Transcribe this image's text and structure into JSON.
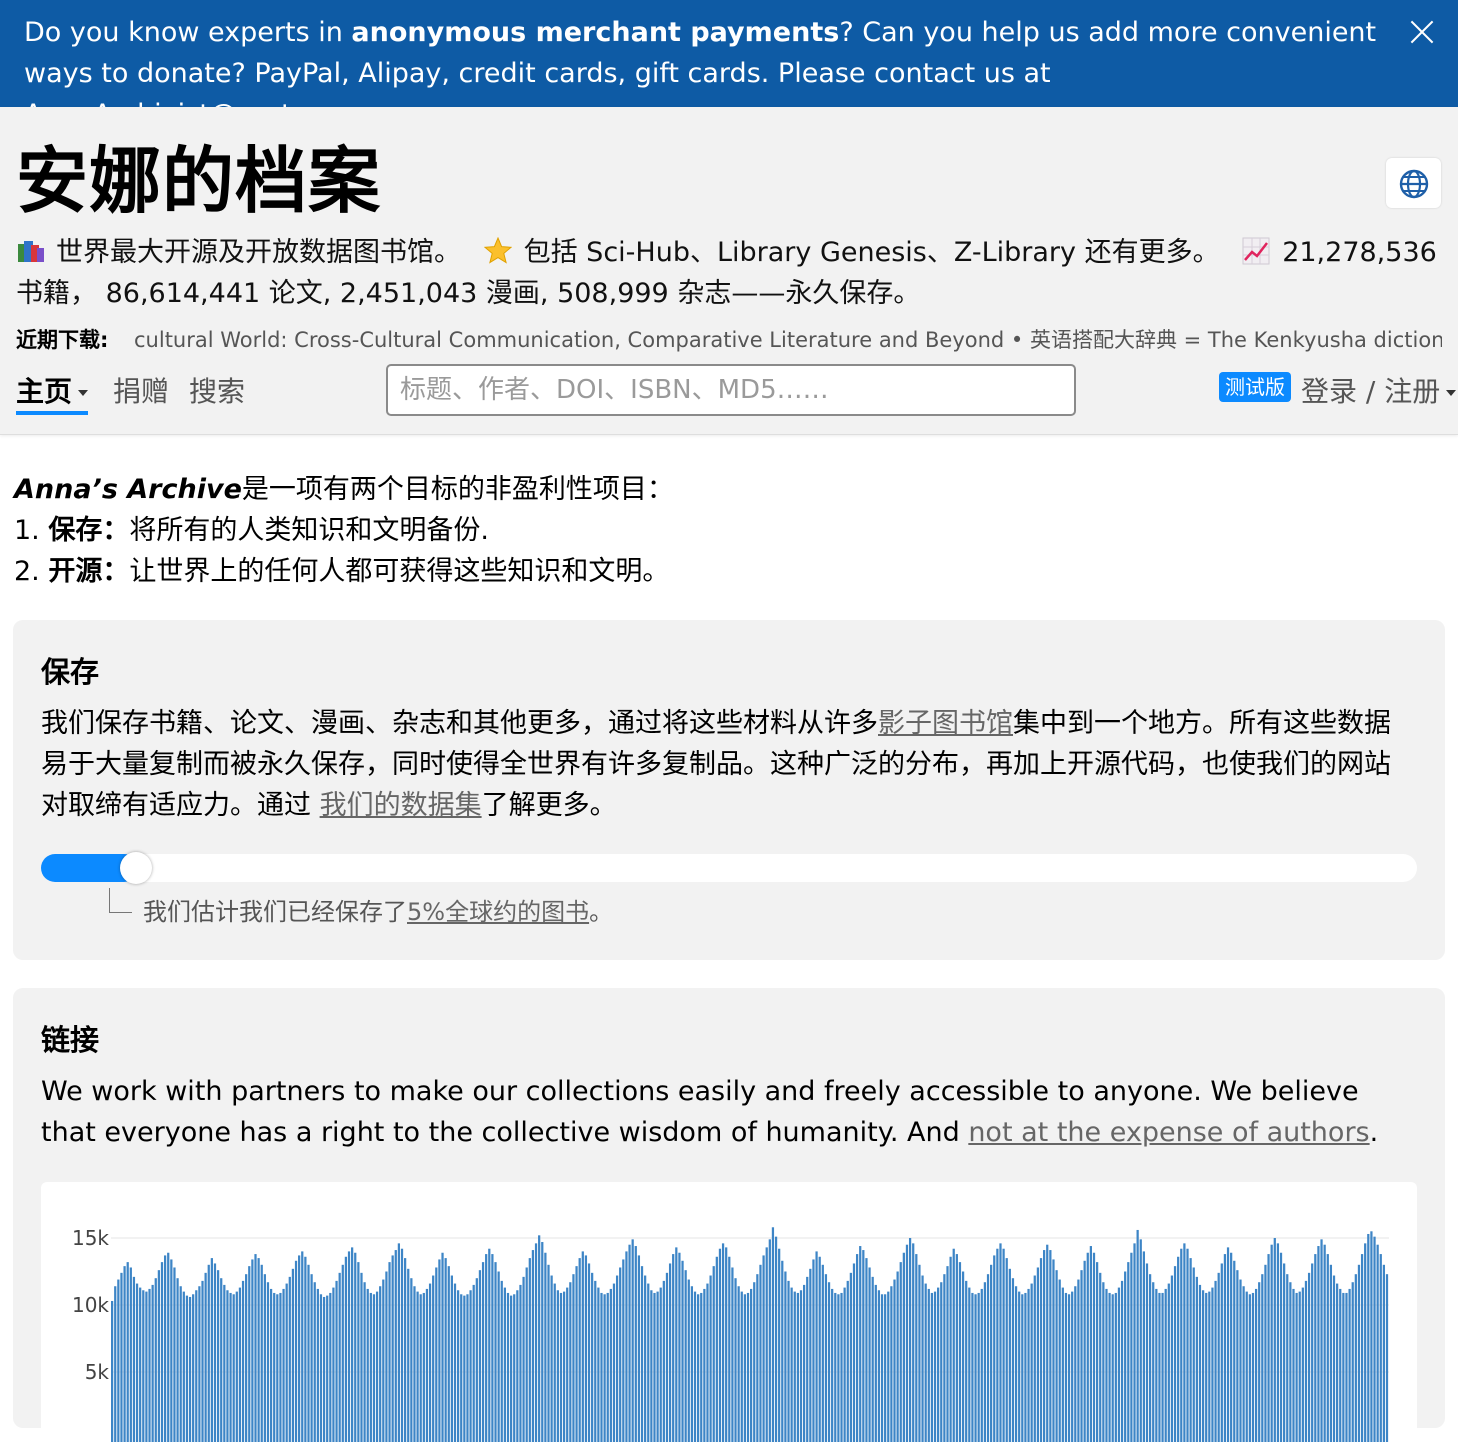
{
  "banner": {
    "part1": "Do you know experts in ",
    "bold": "anonymous merchant payments",
    "part2": "? Can you help us add more convenient ways to donate? PayPal, Alipay, credit cards, gift cards. Please contact us at ",
    "email": "AnnaArchivist@proton.me",
    "part3": ".",
    "close_icon": "close-icon"
  },
  "header": {
    "title": "安娜的档案",
    "language_icon": "globe-icon",
    "stats": {
      "icon1": "books-icon",
      "text1": "世界最大开源及开放数据图书馆。",
      "icon2": "star-icon",
      "text2": "包括 Sci-Hub、Library Genesis、Z-Library 还有更多。",
      "icon3": "chart-increasing-icon",
      "text3": "21,278,536 书籍， 86,614,441 论文, 2,451,043 漫画, 508,999 杂志——永久保存。"
    },
    "recent_label": "近期下载:",
    "recent_ticker": "cultural World: Cross-Cultural Communication, Comparative Literature and Beyond • 英语搭配大辞典 = The Kenkyusha dictionary of E",
    "nav": {
      "home": "主页",
      "donate": "捐赠",
      "search": "搜索"
    },
    "search_placeholder": "标题、作者、DOI、ISBN、MD5……",
    "beta_badge": "测试版",
    "login": "登录 / 注册"
  },
  "intro": {
    "brand": "Anna’s Archive",
    "lead": "是一项有两个目标的非盈利性项目：",
    "item1_num": "1. ",
    "item1_term": "保存：",
    "item1_text": "将所有的人类知识和文明备份.",
    "item2_num": "2. ",
    "item2_term": "开源：",
    "item2_text": "让世界上的任何人都可获得这些知识和文明。"
  },
  "preserve": {
    "heading": "保存",
    "text_a": "我们保存书籍、论文、漫画、杂志和其他更多，通过将这些材料从许多",
    "link_shadow": "影子图书馆",
    "text_b": "集中到一个地方。所有这些数据易于大量复制而被永久保存，同时使得全世界有许多复制品。这种广泛的分布，再加上开源代码，也使我们的网站对取缔有适应力。通过 ",
    "link_datasets": "我们的数据集",
    "text_c": "了解更多。",
    "progress_fraction": 0.05,
    "progress_color": "#0c8aff",
    "note_a": "我们估计我们已经保存了",
    "note_link": "5%全球约的图书",
    "note_b": "。"
  },
  "links": {
    "heading": "链接",
    "text_a": "We work with partners to make our collections easily and freely accessible to anyone. We believe that everyone has a right to the collective wisdom of humanity. And ",
    "link": "not at the expense of authors",
    "text_b": "."
  },
  "chart_data": {
    "type": "bar",
    "title": "",
    "xlabel": "",
    "ylabel": "",
    "ylim": [
      0,
      17000
    ],
    "yticks": [
      "5k",
      "10k",
      "15k"
    ],
    "ytick_values": [
      5000,
      10000,
      15000
    ],
    "bar_color": "#3d85c6",
    "grid": true,
    "values": [
      10300,
      11400,
      11900,
      12400,
      12900,
      13200,
      12800,
      12100,
      11600,
      11300,
      11100,
      11000,
      11200,
      11500,
      12000,
      12600,
      13200,
      13700,
      13900,
      13400,
      12800,
      12000,
      11400,
      11000,
      10700,
      10600,
      10800,
      11100,
      11400,
      11800,
      12400,
      13000,
      13500,
      13100,
      12600,
      12000,
      11500,
      11100,
      10900,
      10800,
      11000,
      11300,
      11800,
      12300,
      12900,
      13400,
      13800,
      13500,
      13000,
      12300,
      11700,
      11200,
      10900,
      10800,
      10900,
      11200,
      11600,
      12100,
      12700,
      13300,
      13700,
      14000,
      13600,
      13000,
      12300,
      11700,
      11200,
      10800,
      10600,
      10700,
      10900,
      11300,
      11800,
      12400,
      13000,
      13600,
      14000,
      14300,
      13900,
      13200,
      12400,
      11700,
      11200,
      10900,
      10800,
      11000,
      11400,
      11900,
      12500,
      13200,
      13700,
      14100,
      14600,
      14200,
      13500,
      12700,
      12000,
      11400,
      11000,
      10800,
      10900,
      11200,
      11600,
      12200,
      12800,
      13400,
      13900,
      13500,
      12900,
      12200,
      11600,
      11100,
      10800,
      10700,
      10800,
      11100,
      11500,
      12000,
      12600,
      13200,
      13800,
      14200,
      13800,
      13200,
      12500,
      11800,
      11300,
      10900,
      10700,
      10800,
      11100,
      11500,
      12100,
      12800,
      13500,
      14100,
      14600,
      15200,
      14700,
      13900,
      13000,
      12200,
      11600,
      11100,
      10900,
      11000,
      11300,
      11700,
      12300,
      12900,
      13500,
      14000,
      13700,
      13100,
      12400,
      11800,
      11300,
      10900,
      10800,
      10900,
      11200,
      11600,
      12200,
      12800,
      13400,
      14000,
      14500,
      14900,
      14400,
      13700,
      12900,
      12200,
      11600,
      11100,
      10900,
      11000,
      11300,
      11800,
      12400,
      13100,
      13800,
      14300,
      13900,
      13300,
      12600,
      11900,
      11400,
      11000,
      10800,
      10900,
      11200,
      11600,
      12200,
      12900,
      13600,
      14200,
      14600,
      14300,
      13600,
      12800,
      12000,
      11400,
      11000,
      10800,
      10900,
      11200,
      11700,
      12300,
      13000,
      13700,
      14300,
      14900,
      15800,
      15100,
      14200,
      13300,
      12500,
      11800,
      11300,
      11000,
      10900,
      11100,
      11500,
      12100,
      12700,
      13400,
      14000,
      13600,
      13000,
      12300,
      11700,
      11200,
      10900,
      10800,
      10900,
      11300,
      11800,
      12400,
      13100,
      13800,
      14400,
      14100,
      13500,
      12800,
      12100,
      11500,
      11100,
      10800,
      10800,
      11000,
      11400,
      11900,
      12500,
      13200,
      13900,
      14500,
      15000,
      14600,
      13800,
      13000,
      12200,
      11600,
      11200,
      10900,
      11000,
      11300,
      11700,
      12300,
      12900,
      13600,
      14200,
      13800,
      13200,
      12500,
      11800,
      11300,
      10900,
      10800,
      10900,
      11200,
      11700,
      12300,
      13000,
      13700,
      14200,
      14600,
      14200,
      13500,
      12700,
      12000,
      11400,
      11000,
      10800,
      10900,
      11200,
      11600,
      12200,
      12800,
      13500,
      14100,
      14500,
      14100,
      13400,
      12600,
      11900,
      11300,
      10900,
      10800,
      11000,
      11400,
      11900,
      12600,
      13300,
      13900,
      14400,
      13900,
      13200,
      12400,
      11700,
      11200,
      10900,
      10800,
      10900,
      11300,
      11800,
      12500,
      13200,
      13900,
      14600,
      15600,
      14900,
      14000,
      13100,
      12300,
      11700,
      11200,
      10900,
      10900,
      11200,
      11600,
      12200,
      12900,
      13600,
      14200,
      14600,
      14200,
      13500,
      12800,
      12100,
      11500,
      11100,
      10900,
      11000,
      11300,
      11800,
      12400,
      13100,
      13800,
      14300,
      13900,
      13300,
      12600,
      11900,
      11400,
      11000,
      10800,
      10900,
      11200,
      11700,
      12300,
      13000,
      13800,
      14500,
      15000,
      14600,
      13900,
      13100,
      12300,
      11700,
      11200,
      10900,
      11000,
      11300,
      11800,
      12400,
      13100,
      13800,
      14400,
      14900,
      14500,
      13800,
      13000,
      12200,
      11600,
      11200,
      10900,
      10900,
      11200,
      11700,
      12300,
      13000,
      13800,
      14600,
      15300,
      15500,
      15100,
      14500,
      13800,
      13000,
      12300
    ]
  }
}
